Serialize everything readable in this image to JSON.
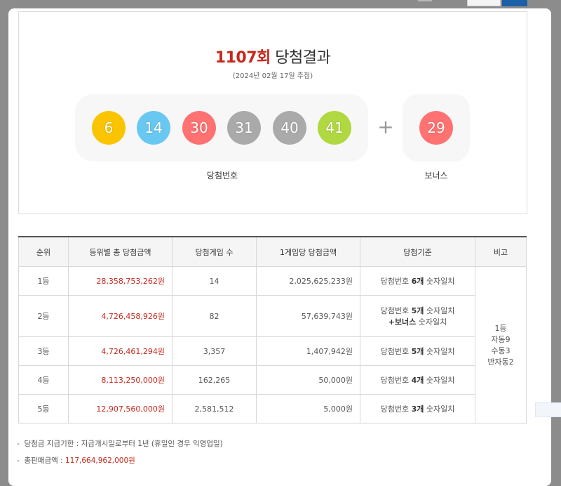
{
  "result": {
    "round": "1107회",
    "title_suffix": " 당첨결과",
    "date": "(2024년 02월 17일 추첨)",
    "numbers": [
      {
        "value": "6",
        "color": "#fbc400"
      },
      {
        "value": "14",
        "color": "#69c8f2"
      },
      {
        "value": "30",
        "color": "#ff7272"
      },
      {
        "value": "31",
        "color": "#aaaaaa"
      },
      {
        "value": "40",
        "color": "#aaaaaa"
      },
      {
        "value": "41",
        "color": "#b0d840"
      }
    ],
    "plus": "+",
    "bonus": {
      "value": "29",
      "color": "#ff7272"
    },
    "numbers_label": "당첨번호",
    "bonus_label": "보너스"
  },
  "table": {
    "headers": [
      "순위",
      "등위별 총 당첨금액",
      "당첨게임 수",
      "1게임당 당첨금액",
      "당첨기준",
      "비고"
    ],
    "rows": [
      {
        "rank": "1등",
        "total": "28,358,753,262원",
        "winners": "14",
        "per_game": "2,025,625,233원",
        "criteria_pre": "당첨번호 ",
        "criteria_bold": "6개",
        "criteria_post": " 숫자일치",
        "criteria_line2": ""
      },
      {
        "rank": "2등",
        "total": "4,726,458,926원",
        "winners": "82",
        "per_game": "57,639,743원",
        "criteria_pre": "당첨번호 ",
        "criteria_bold": "5개",
        "criteria_post": " 숫자일치",
        "criteria_line2_bold": "+보너스",
        "criteria_line2": " 숫자일치"
      },
      {
        "rank": "3등",
        "total": "4,726,461,294원",
        "winners": "3,357",
        "per_game": "1,407,942원",
        "criteria_pre": "당첨번호 ",
        "criteria_bold": "5개",
        "criteria_post": " 숫자일치",
        "criteria_line2": ""
      },
      {
        "rank": "4등",
        "total": "8,113,250,000원",
        "winners": "162,265",
        "per_game": "50,000원",
        "criteria_pre": "당첨번호 ",
        "criteria_bold": "4개",
        "criteria_post": " 숫자일치",
        "criteria_line2": ""
      },
      {
        "rank": "5등",
        "total": "12,907,560,000원",
        "winners": "2,581,512",
        "per_game": "5,000원",
        "criteria_pre": "당첨번호 ",
        "criteria_bold": "3개",
        "criteria_post": " 숫자일치",
        "criteria_line2": ""
      }
    ],
    "remark": [
      "1등",
      "자동9",
      "수동3",
      "반자동2"
    ]
  },
  "notes": {
    "deadline": "당첨금 지급기한 : 지급개시일로부터 1년 (휴일인 경우 익영업일)",
    "sales_label": "총판매금액 : ",
    "sales_value": "117,664,962,000원"
  }
}
